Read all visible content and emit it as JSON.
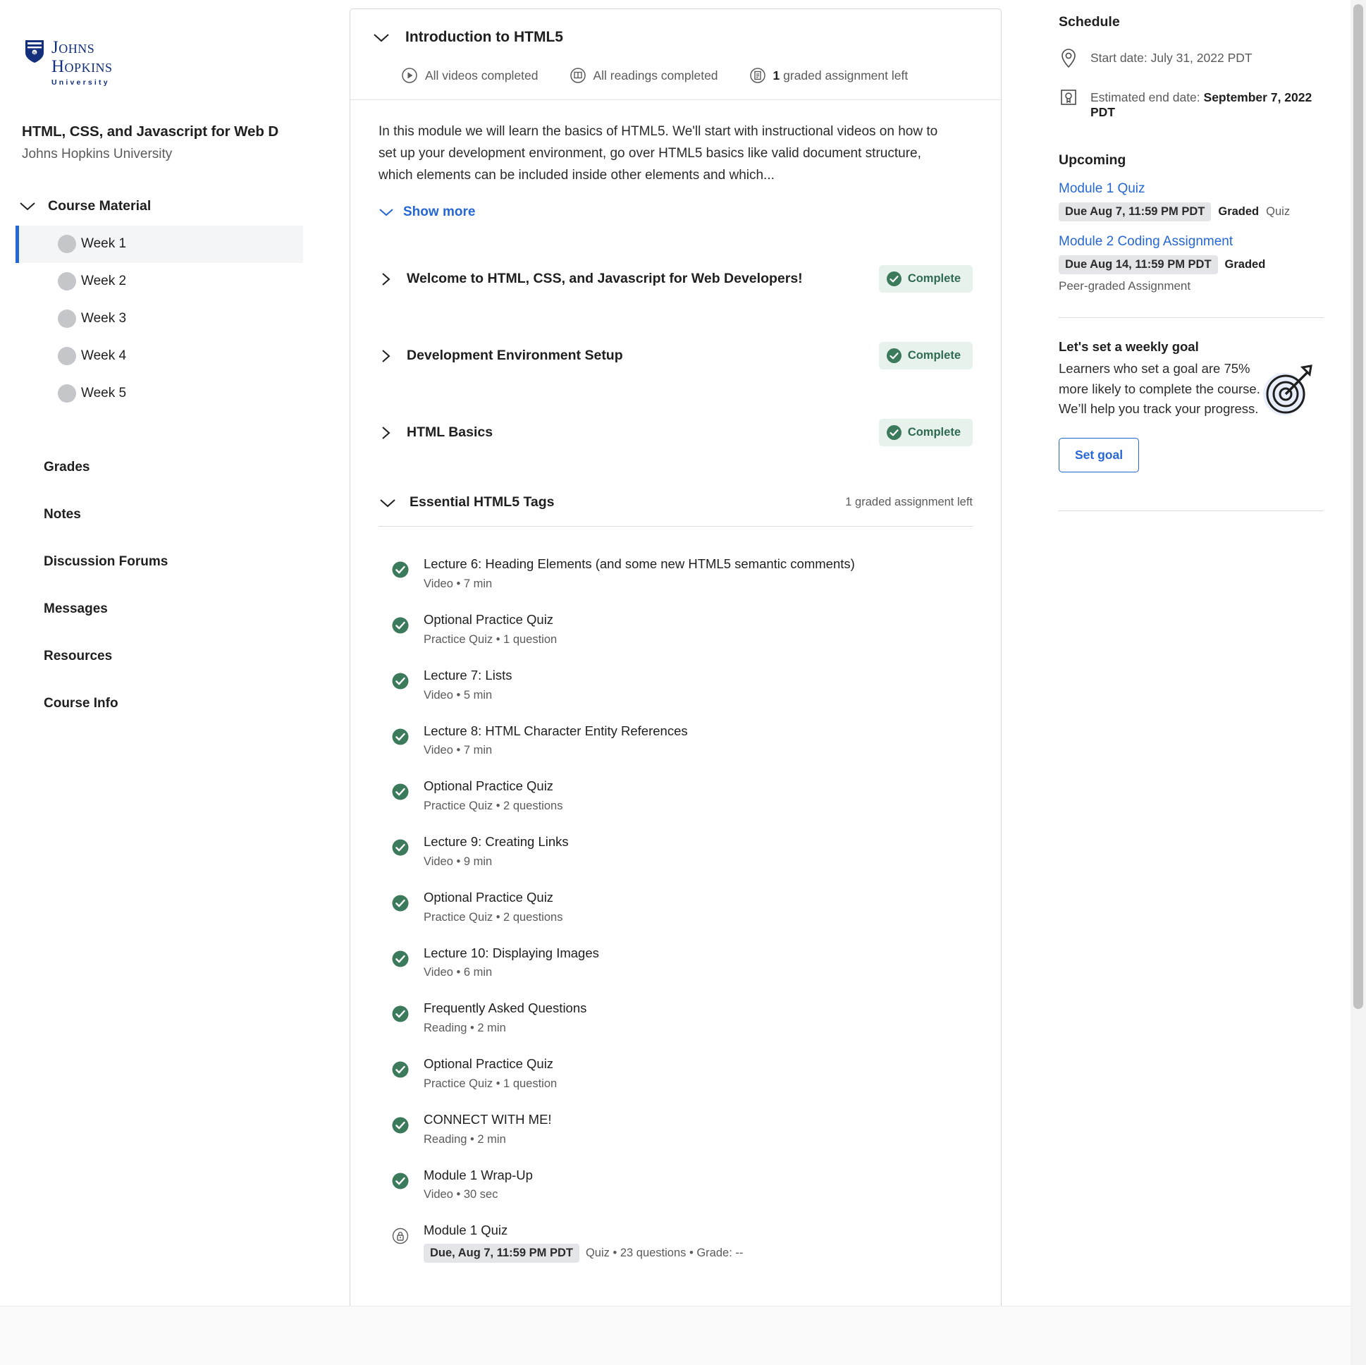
{
  "sidebar": {
    "logo": {
      "line1": "Johns",
      "line2": "Hopkins",
      "line3": "University",
      "icon": "jhu-shield-icon"
    },
    "course_title": "HTML, CSS, and Javascript for Web Deve",
    "course_org": "Johns Hopkins University",
    "section_label": "Course Material",
    "weeks": [
      {
        "label": "Week 1",
        "active": true
      },
      {
        "label": "Week 2",
        "active": false
      },
      {
        "label": "Week 3",
        "active": false
      },
      {
        "label": "Week 4",
        "active": false
      },
      {
        "label": "Week 5",
        "active": false
      }
    ],
    "links": [
      "Grades",
      "Notes",
      "Discussion Forums",
      "Messages",
      "Resources",
      "Course Info"
    ]
  },
  "module": {
    "title": "Introduction to HTML5",
    "statuses": [
      {
        "icon": "play-circle-icon",
        "text": "All videos completed",
        "strong": ""
      },
      {
        "icon": "book-circle-icon",
        "text": "All readings completed",
        "strong": ""
      },
      {
        "icon": "document-circle-icon",
        "text": " graded assignment left",
        "strong": "1"
      }
    ],
    "description": "In this module we will learn the basics of HTML5. We'll start with instructional videos on how to set up your development environment, go over HTML5 basics like valid document structure, which elements can be included inside other elements and which...",
    "show_more": "Show more",
    "groups": [
      {
        "title": "Welcome to HTML, CSS, and Javascript for Web Developers!",
        "badge": "Complete",
        "expanded": false
      },
      {
        "title": "Development Environment Setup",
        "badge": "Complete",
        "expanded": false
      },
      {
        "title": "HTML Basics",
        "badge": "Complete",
        "expanded": false
      }
    ],
    "open_group": {
      "title": "Essential HTML5 Tags",
      "meta": "1 graded assignment left",
      "items": [
        {
          "title": "Lecture 6: Heading Elements (and some new HTML5 semantic comments)",
          "sub": "Video • 7 min",
          "icon": "check-circle-icon"
        },
        {
          "title": "Optional Practice Quiz",
          "sub": "Practice Quiz • 1 question",
          "icon": "check-circle-icon"
        },
        {
          "title": "Lecture 7: Lists",
          "sub": "Video • 5 min",
          "icon": "check-circle-icon"
        },
        {
          "title": "Lecture 8: HTML Character Entity References",
          "sub": "Video • 7 min",
          "icon": "check-circle-icon"
        },
        {
          "title": "Optional Practice Quiz",
          "sub": "Practice Quiz • 2 questions",
          "icon": "check-circle-icon"
        },
        {
          "title": "Lecture 9: Creating Links",
          "sub": "Video • 9 min",
          "icon": "check-circle-icon"
        },
        {
          "title": "Optional Practice Quiz",
          "sub": "Practice Quiz • 2 questions",
          "icon": "check-circle-icon"
        },
        {
          "title": "Lecture 10: Displaying Images",
          "sub": "Video • 6 min",
          "icon": "check-circle-icon"
        },
        {
          "title": "Frequently Asked Questions",
          "sub": "Reading • 2 min",
          "icon": "check-circle-icon"
        },
        {
          "title": "Optional Practice Quiz",
          "sub": "Practice Quiz • 1 question",
          "icon": "check-circle-icon"
        },
        {
          "title": "CONNECT WITH ME!",
          "sub": "Reading • 2 min",
          "icon": "check-circle-icon"
        },
        {
          "title": "Module 1 Wrap-Up",
          "sub": "Video • 30 sec",
          "icon": "check-circle-icon"
        },
        {
          "title": "Module 1 Quiz",
          "sub": "Quiz • 23 questions • Grade: --",
          "chip": "Due, Aug 7, 11:59 PM PDT",
          "icon": "lock-circle-icon"
        }
      ]
    }
  },
  "right": {
    "schedule_heading": "Schedule",
    "start": "Start date: July 31, 2022 PDT",
    "end_label": "Estimated end date: ",
    "end_value": "September 7, 2022 PDT",
    "upcoming_heading": "Upcoming",
    "upcoming": [
      {
        "link": "Module 1 Quiz",
        "chip": "Due Aug 7, 11:59 PM PDT",
        "graded": "Graded",
        "type": "Quiz",
        "extra": ""
      },
      {
        "link": "Module 2 Coding Assignment",
        "chip": "Due Aug 14, 11:59 PM PDT",
        "graded": "Graded",
        "type": "",
        "extra": "Peer-graded Assignment"
      }
    ],
    "goal_heading": "Let's set a weekly goal",
    "goal_body": "Learners who set a goal are 75% more likely to complete the course. We’ll help you track your progress.",
    "goal_button": "Set goal",
    "goal_icon": "target-dart-icon"
  },
  "colors": {
    "accent": "#2667d6",
    "complete_green": "#2f6b4f",
    "complete_bg": "#e8f2ec",
    "chip_bg": "#e4e5e8"
  }
}
